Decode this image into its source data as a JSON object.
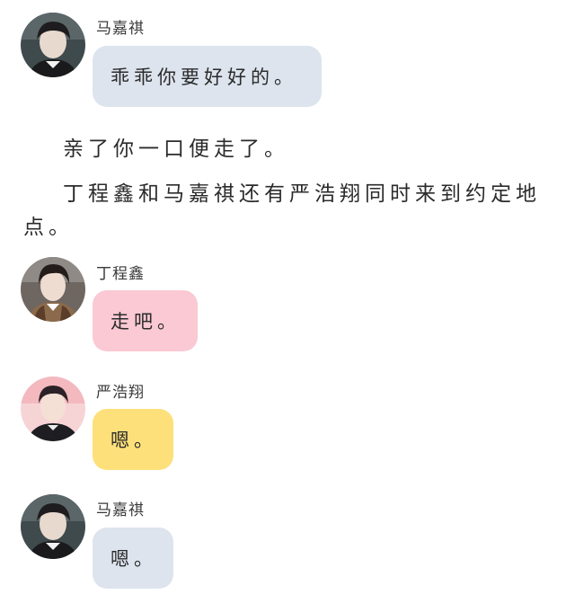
{
  "messages": [
    {
      "speaker": "马嘉祺",
      "text": "乖乖你要好好的。",
      "bubble_color": "#dde4ee"
    },
    {
      "speaker": "丁程鑫",
      "text": "走吧。",
      "bubble_color": "#fac9d3"
    },
    {
      "speaker": "严浩翔",
      "text": "嗯。",
      "bubble_color": "#fde07a"
    },
    {
      "speaker": "马嘉祺",
      "text": "嗯。",
      "bubble_color": "#dde4ee"
    }
  ],
  "narration": {
    "line1": "亲了你一口便走了。",
    "line2": "丁程鑫和马嘉祺还有严浩翔同时来到约定地",
    "line3": "点。"
  },
  "avatar_icons": [
    "person-avatar-icon",
    "person-avatar-icon",
    "person-avatar-icon",
    "person-avatar-icon"
  ]
}
